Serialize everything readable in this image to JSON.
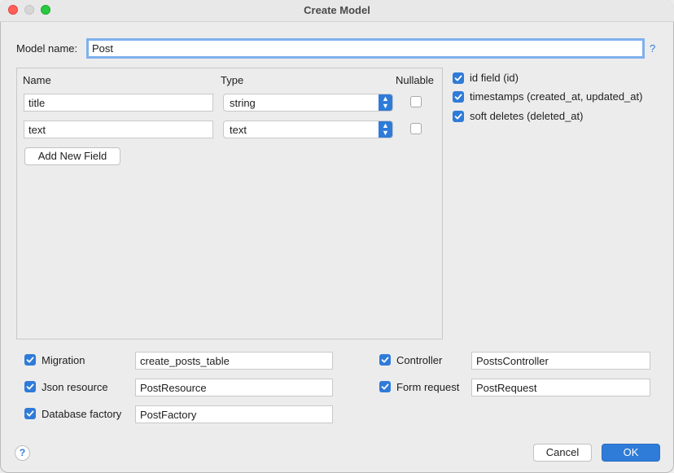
{
  "window": {
    "title": "Create Model"
  },
  "model": {
    "label": "Model name:",
    "value": "Post",
    "help": "?"
  },
  "fields_table": {
    "headers": {
      "name": "Name",
      "type": "Type",
      "nullable": "Nullable"
    },
    "rows": [
      {
        "name": "title",
        "type": "string",
        "nullable": false
      },
      {
        "name": "text",
        "type": "text",
        "nullable": false
      }
    ],
    "add_label": "Add New Field"
  },
  "options": [
    {
      "label": "id field (id)",
      "checked": true
    },
    {
      "label": "timestamps (created_at, updated_at)",
      "checked": true
    },
    {
      "label": "soft deletes (deleted_at)",
      "checked": true
    }
  ],
  "generators": {
    "migration": {
      "label": "Migration",
      "value": "create_posts_table",
      "checked": true
    },
    "json_resource": {
      "label": "Json resource",
      "value": "PostResource",
      "checked": true
    },
    "database_factory": {
      "label": "Database factory",
      "value": "PostFactory",
      "checked": true
    },
    "controller": {
      "label": "Controller",
      "value": "PostsController",
      "checked": true
    },
    "form_request": {
      "label": "Form request",
      "value": "PostRequest",
      "checked": true
    }
  },
  "footer": {
    "help": "?",
    "cancel_label": "Cancel",
    "ok_label": "OK"
  },
  "colors": {
    "accent": "#2f7bd8",
    "focus_ring": "#7fb1ec"
  }
}
